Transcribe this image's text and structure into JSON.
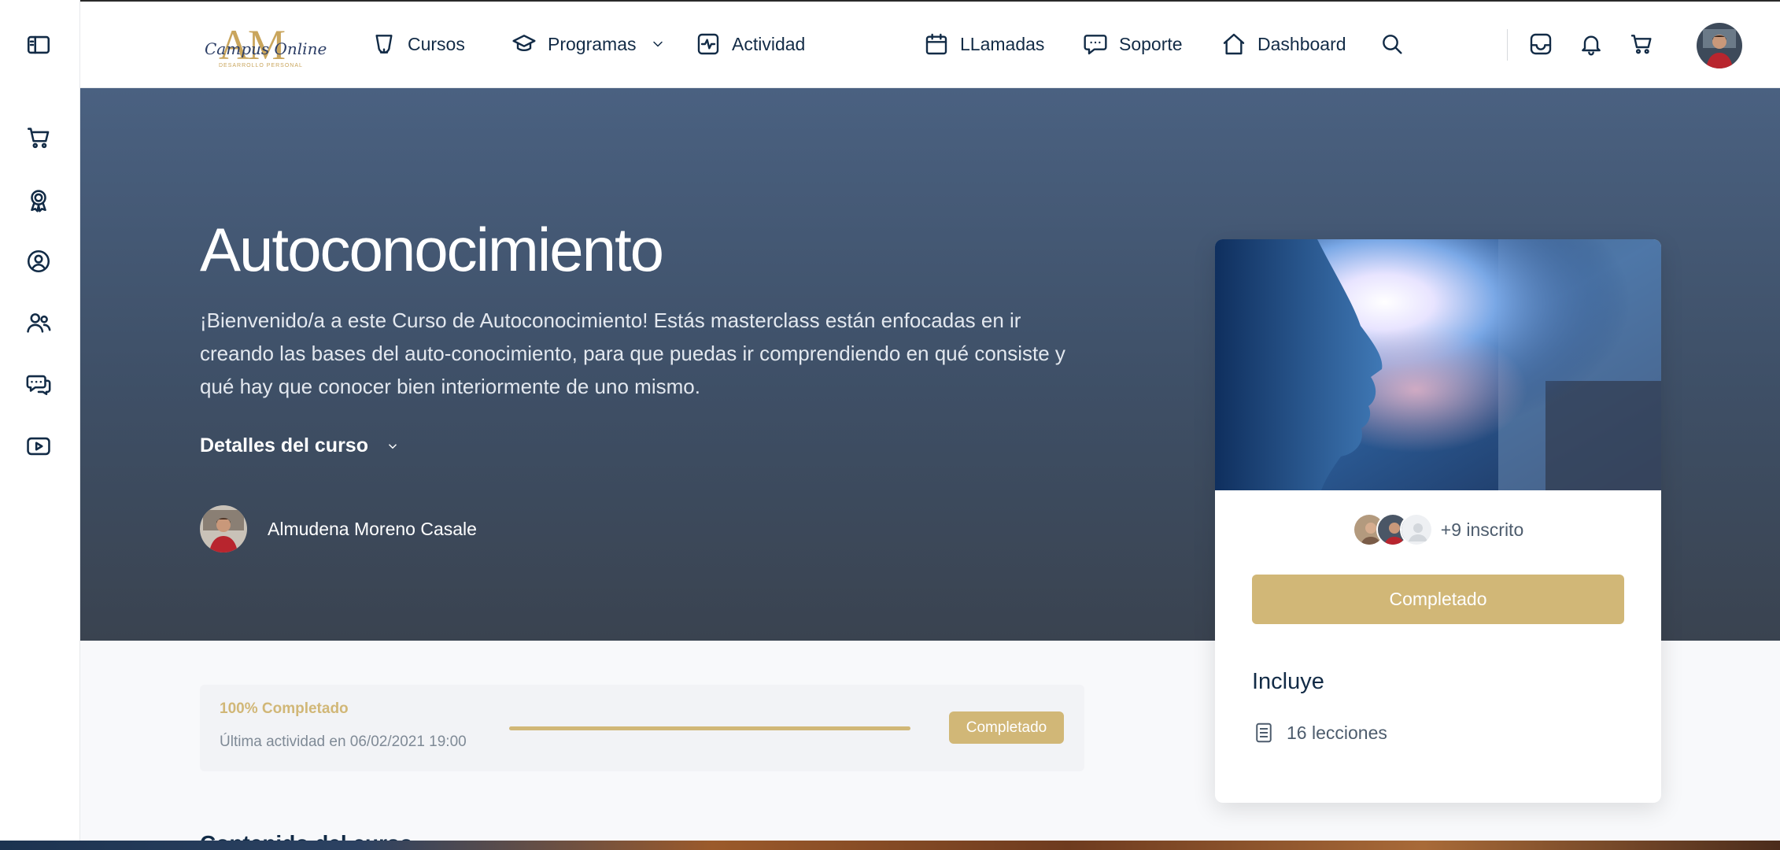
{
  "brand": {
    "logo_mark": "AM",
    "logo_script": "Campus Online",
    "logo_subtitle": "DESARROLLO PERSONAL"
  },
  "nav": [
    {
      "label": "Cursos",
      "icon": "cup-icon"
    },
    {
      "label": "Programas",
      "icon": "graduation-cap-icon"
    },
    {
      "label": "Actividad",
      "icon": "activity-icon"
    },
    {
      "label": "LLamadas",
      "icon": "calendar-icon"
    },
    {
      "label": "Soporte",
      "icon": "chat-icon"
    },
    {
      "label": "Dashboard",
      "icon": "home-icon"
    }
  ],
  "header_icons": [
    "search-icon",
    "inbox-icon",
    "bell-icon",
    "cart-icon",
    "avatar"
  ],
  "rail_icons": [
    "sidebar-toggle-icon",
    "cart-icon",
    "badge-icon",
    "profile-icon",
    "members-icon",
    "forum-icon",
    "video-icon"
  ],
  "course": {
    "title": "Autoconocimiento",
    "description": "¡Bienvenido/a a este Curso de Autoconocimiento! Estás masterclass están enfocadas en ir creando las bases del auto-conocimiento, para que puedas ir comprendiendo en qué consiste y qué hay que conocer bien interiormente de uno mismo.",
    "details_label": "Detalles del curso",
    "author": "Almudena Moreno Casale"
  },
  "card": {
    "enrolled_text": "+9 inscrito",
    "button_label": "Completado",
    "includes_title": "Incluye",
    "includes_items": [
      {
        "icon": "lesson-icon",
        "text": "16 lecciones"
      }
    ]
  },
  "progress": {
    "percent_label": "100% Completado",
    "last_activity": "Última actividad en 06/02/2021 19:00",
    "value": 1.0,
    "badge": "Completado"
  },
  "content_heading": "Contenido del curso",
  "colors": {
    "accent_gold": "#d1b777",
    "navy": "#122b46",
    "hero_top": "#4a6181",
    "hero_bottom": "#3a4350"
  }
}
